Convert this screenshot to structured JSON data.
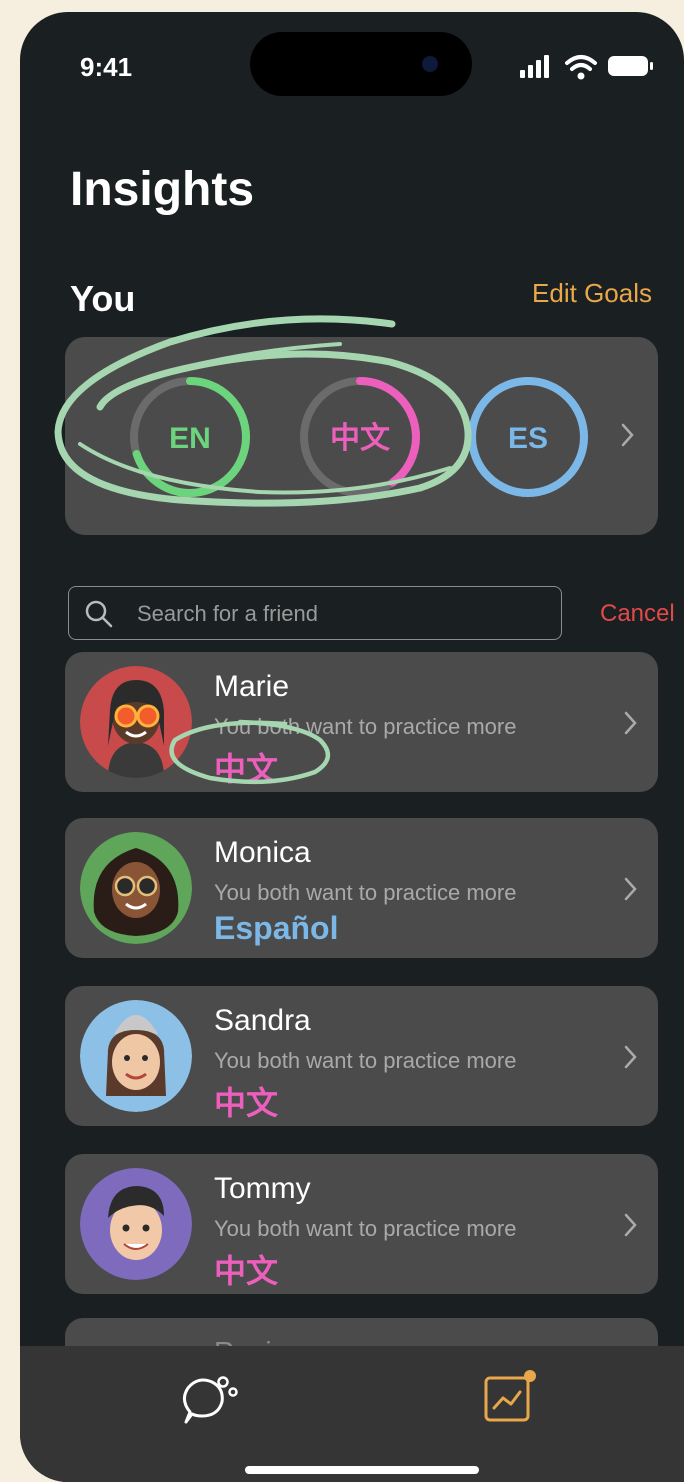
{
  "status_bar": {
    "time": "9:41"
  },
  "header": {
    "title": "Insights"
  },
  "you_section": {
    "title": "You",
    "edit_goals": "Edit Goals",
    "goals": [
      {
        "code": "EN",
        "color": "#6dd47e",
        "progress": 0.7
      },
      {
        "code": "中文",
        "color": "#ec5fbc",
        "progress": 0.4
      },
      {
        "code": "ES",
        "color": "#7bb8e8",
        "progress": 1.0
      }
    ]
  },
  "search": {
    "placeholder": "Search for a friend",
    "cancel": "Cancel"
  },
  "friends": [
    {
      "name": "Marie",
      "description": "You both want to practice more",
      "language": "中文",
      "language_color": "#ec5fbc",
      "avatar_color": "#c94a4a"
    },
    {
      "name": "Monica",
      "description": "You both want to practice more",
      "language": "Español",
      "language_color": "#7bb8e8",
      "avatar_color": "#5fa65a"
    },
    {
      "name": "Sandra",
      "description": "You both want to practice more",
      "language": "中文",
      "language_color": "#ec5fbc",
      "avatar_color": "#8cc0e6"
    },
    {
      "name": "Tommy",
      "description": "You both want to practice more",
      "language": "中文",
      "language_color": "#ec5fbc",
      "avatar_color": "#7f6bbd"
    }
  ],
  "partial_friend": {
    "name": "Regina"
  },
  "colors": {
    "accent": "#e8a74a",
    "cancel": "#e24a4a",
    "annotation": "#a5d6b0"
  },
  "tab_bar": {
    "tabs": [
      {
        "icon": "chat-bubble-icon"
      },
      {
        "icon": "insights-chart-icon",
        "badge": true
      }
    ]
  }
}
